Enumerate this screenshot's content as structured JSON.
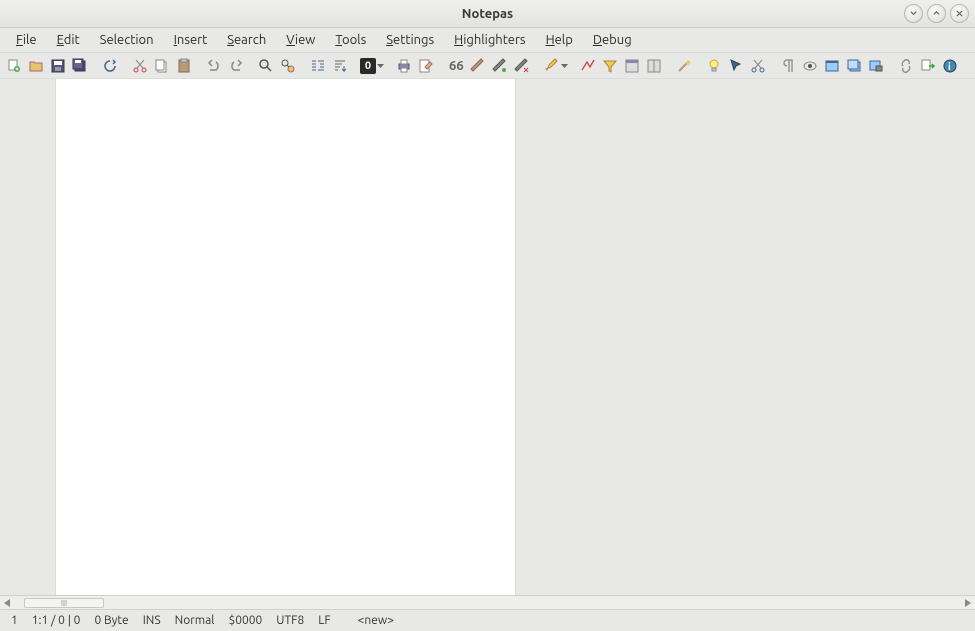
{
  "window": {
    "title": "Notepas"
  },
  "menu": {
    "file": "File",
    "edit": "Edit",
    "selection": "Selection",
    "insert": "Insert",
    "search": "Search",
    "view": "View",
    "tools": "Tools",
    "settings": "Settings",
    "highlighters": "Highlighters",
    "help": "Help",
    "debug": "Debug"
  },
  "toolbar": {
    "fold_level": "0",
    "icons": {
      "new": "new-file-icon",
      "open": "open-file-icon",
      "save": "save-icon",
      "save_all": "save-all-icon",
      "refresh": "refresh-icon",
      "cut": "cut-icon",
      "copy": "copy-icon",
      "paste": "paste-icon",
      "undo": "undo-icon",
      "redo": "redo-icon",
      "find": "find-icon",
      "replace": "replace-icon",
      "indent": "indent-icon",
      "sort": "sort-icon",
      "fold": "fold-level-icon",
      "print": "print-icon",
      "edit_mode": "edit-icon",
      "quote": "quote-icon",
      "brush1": "brush-icon",
      "brush2": "brush-edit-icon",
      "brush3": "brush-clear-icon",
      "highlight": "highlight-icon",
      "line1": "line-icon",
      "filter": "filter-icon",
      "panel1": "panel-icon",
      "panel2": "split-panel-icon",
      "magic": "magic-wand-icon",
      "bulb": "lightbulb-icon",
      "pointer": "pointer-icon",
      "cut2": "cut-special-icon",
      "para": "paragraph-icon",
      "eye": "eye-icon",
      "win1": "window-icon",
      "win2": "windows-icon",
      "win3": "window-print-icon",
      "link": "link-icon",
      "export": "export-icon",
      "info": "info-icon"
    }
  },
  "status": {
    "line": "1",
    "position": "1:1 / 0 | 0",
    "size": "0 Byte",
    "mode": "INS",
    "state": "Normal",
    "code": "$0000",
    "encoding": "UTF8",
    "eol": "LF",
    "filename": "<new>"
  }
}
